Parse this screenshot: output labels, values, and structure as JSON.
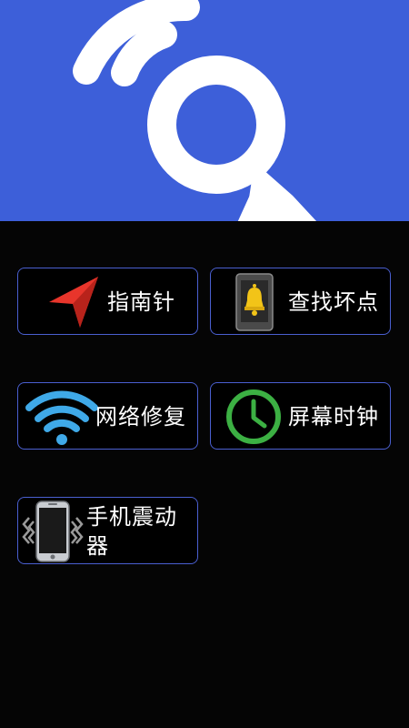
{
  "header": {
    "banner_icon": "search-signal-icon",
    "banner_color": "#3d5fd9"
  },
  "tools": [
    {
      "label": "指南针",
      "icon": "compass-arrow-icon"
    },
    {
      "label": "查找坏点",
      "icon": "bell-screen-icon"
    },
    {
      "label": "网络修复",
      "icon": "wifi-icon"
    },
    {
      "label": "屏幕时钟",
      "icon": "clock-icon"
    },
    {
      "label": "手机震动器",
      "icon": "phone-vibrate-icon"
    }
  ],
  "colors": {
    "tile_border": "#4a5fd0",
    "background": "#050505",
    "compass_red": "#e8352b",
    "wifi_blue": "#3fa9e8",
    "clock_green": "#3cb043",
    "bell_yellow": "#f2c418"
  }
}
